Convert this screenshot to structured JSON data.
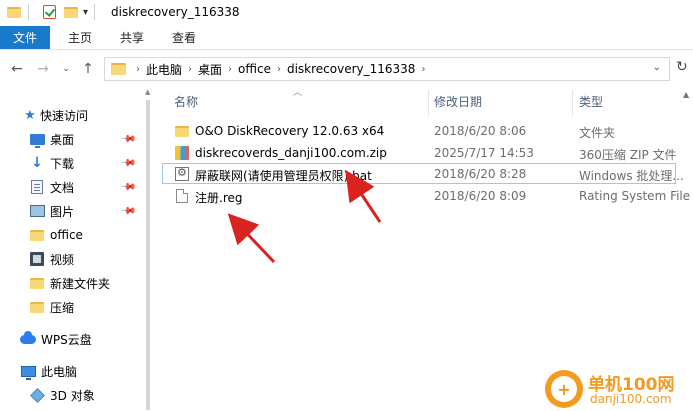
{
  "window": {
    "title": "diskrecovery_116338"
  },
  "ribbon": {
    "tabs": [
      {
        "label": "文件",
        "active": true
      },
      {
        "label": "主页"
      },
      {
        "label": "共享"
      },
      {
        "label": "查看"
      }
    ]
  },
  "address": {
    "crumbs": [
      "此电脑",
      "桌面",
      "office",
      "diskrecovery_116338"
    ]
  },
  "sidebar": {
    "items": [
      {
        "label": "快速访问",
        "icon": "star-icon"
      },
      {
        "label": "桌面",
        "icon": "desktop-icon",
        "pinned": true
      },
      {
        "label": "下载",
        "icon": "download-icon",
        "pinned": true
      },
      {
        "label": "文档",
        "icon": "documents-icon",
        "pinned": true
      },
      {
        "label": "图片",
        "icon": "pictures-icon",
        "pinned": true
      },
      {
        "label": "office",
        "icon": "folder-icon"
      },
      {
        "label": "视频",
        "icon": "video-icon"
      },
      {
        "label": "新建文件夹",
        "icon": "folder-icon"
      },
      {
        "label": "压缩",
        "icon": "folder-icon"
      },
      {
        "label": "WPS云盘",
        "icon": "cloud-icon"
      },
      {
        "label": "此电脑",
        "icon": "computer-icon"
      },
      {
        "label": "3D 对象",
        "icon": "3d-objects-icon"
      }
    ]
  },
  "columns": {
    "name": "名称",
    "date": "修改日期",
    "type": "类型"
  },
  "files": [
    {
      "name": "O&O DiskRecovery 12.0.63 x64",
      "date": "2018/6/20 8:06",
      "type": "文件夹",
      "icon": "folder-icon"
    },
    {
      "name": "diskrecoverds_danji100.com.zip",
      "date": "2025/7/17 14:53",
      "type": "360压缩 ZIP 文件",
      "icon": "zip-icon"
    },
    {
      "name": "屏蔽联网(请使用管理员权限).bat",
      "date": "2018/6/20 8:28",
      "type": "Windows 批处理...",
      "icon": "bat-file-icon",
      "selected": true
    },
    {
      "name": "注册.reg",
      "date": "2018/6/20 8:09",
      "type": "Rating System File",
      "icon": "reg-file-icon"
    }
  ],
  "watermark": {
    "title": "单机100网",
    "url": "danji100.com"
  },
  "colors": {
    "accent": "#1979ca",
    "arrow": "#d9231f",
    "folder": "#f8d775",
    "watermark": "#f39a1f"
  }
}
